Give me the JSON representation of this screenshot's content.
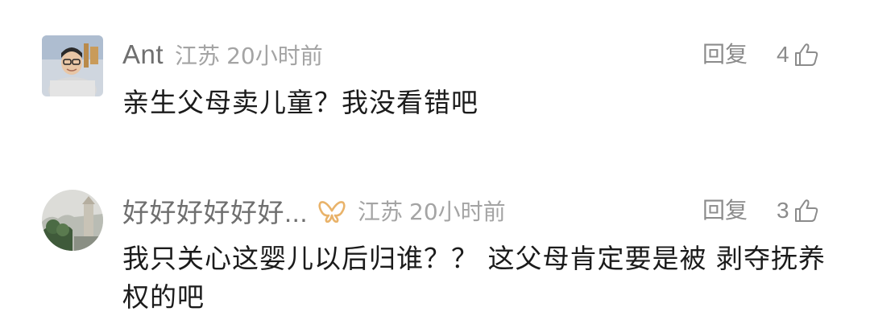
{
  "comments": [
    {
      "avatar_icon": "user-photo-avatar",
      "username": "Ant",
      "location": "江苏",
      "time": "20小时前",
      "reply_label": "回复",
      "likes": "4",
      "text": "亲生父母卖儿童？我没看错吧"
    },
    {
      "avatar_icon": "landscape-avatar",
      "username": "好好好好好好...",
      "badge_icon": "butterfly-badge-icon",
      "location": "江苏",
      "time": "20小时前",
      "reply_label": "回复",
      "likes": "3",
      "text": "我只关心这婴儿以后归谁？？ 这父母肯定要是被 剥夺抚养权的吧"
    }
  ],
  "colors": {
    "username": "#6f6f6f",
    "meta": "#a4a4a4",
    "action": "#8b8b8b",
    "text": "#1b1b1b",
    "badge": "#e9b36a"
  }
}
